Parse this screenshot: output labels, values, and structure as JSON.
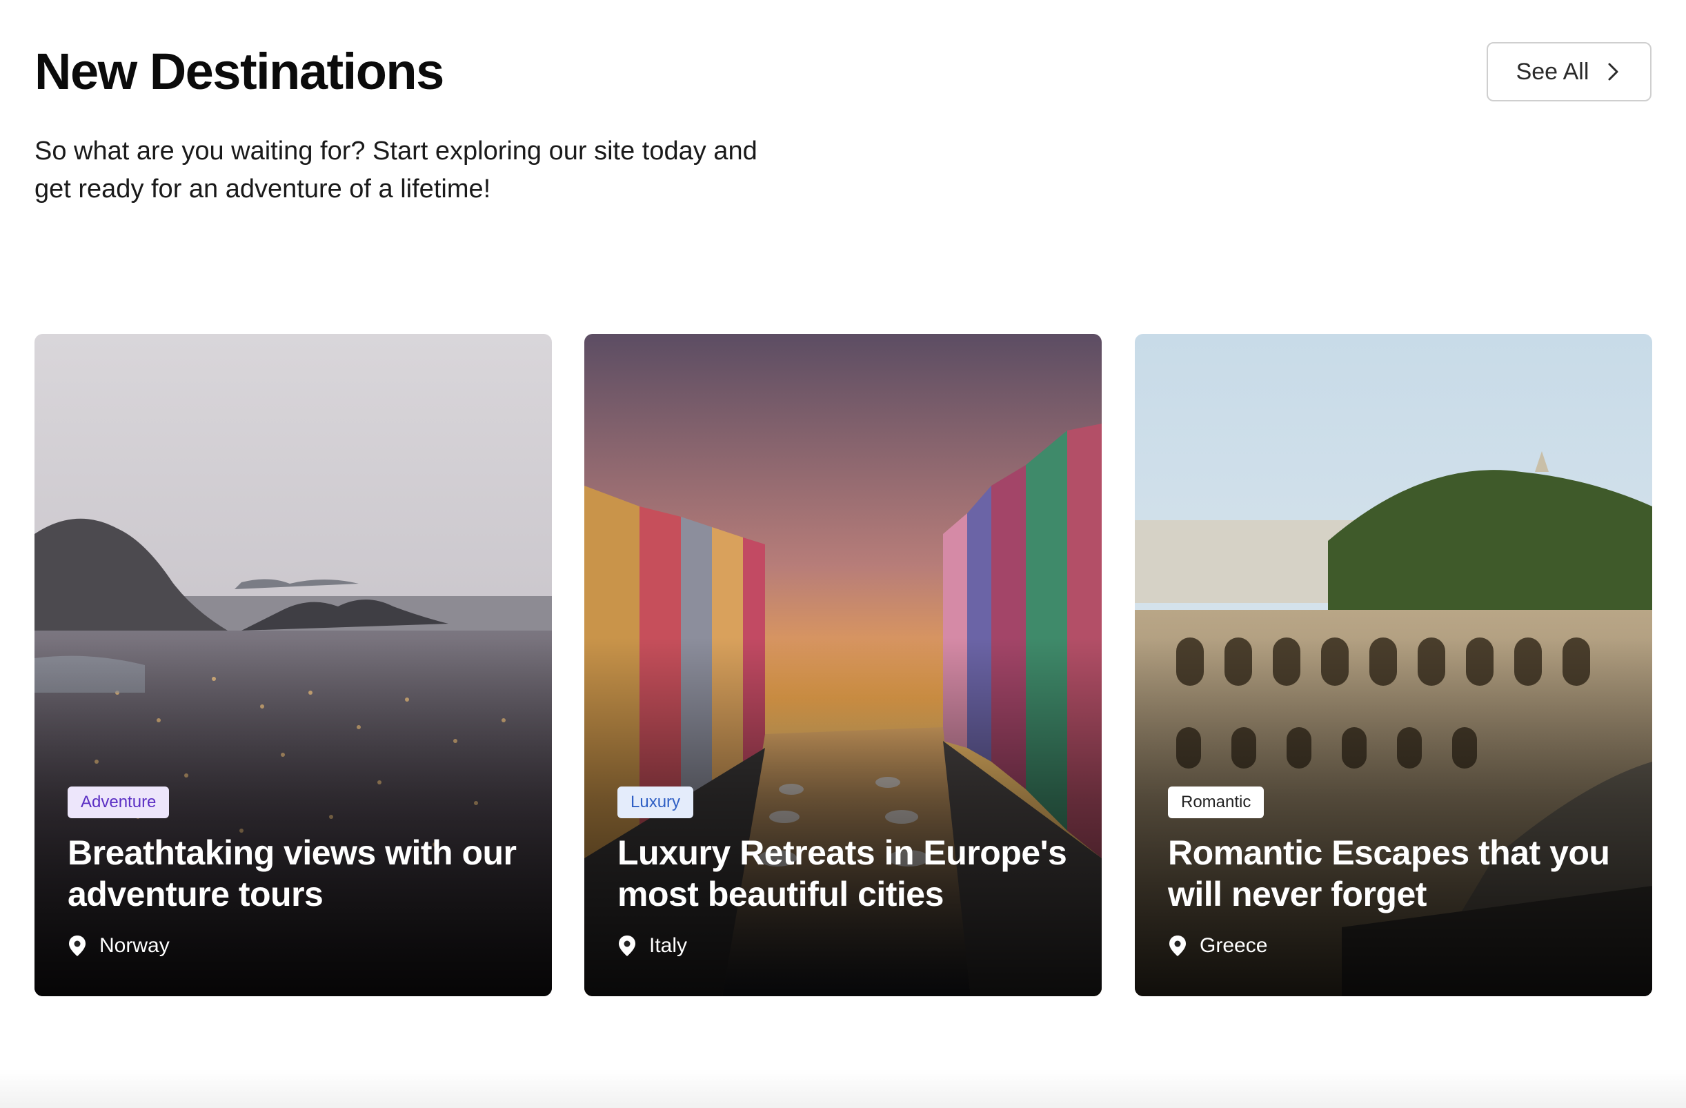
{
  "header": {
    "title": "New Destinations",
    "subtitle": "So what are you waiting for? Start exploring our site today and get ready for an adventure of a lifetime!",
    "see_all_label": "See All",
    "see_all_icon": "chevron-right-icon"
  },
  "cards": [
    {
      "category": "Adventure",
      "title": "Breathtaking views with our adventure tours",
      "location": "Norway",
      "image": "coastal town at dusk with mountains",
      "badge_bg": "#ede6fb",
      "badge_color": "#5b2fc4"
    },
    {
      "category": "Luxury",
      "title": "Luxury Retreats in Europe's most beautiful cities",
      "location": "Italy",
      "image": "colorful houses along a canal at sunset",
      "badge_bg": "#e4ecfb",
      "badge_color": "#2f5fc4"
    },
    {
      "category": "Romantic",
      "title": "Romantic Escapes that you will never forget",
      "location": "Greece",
      "image": "ancient stone theatre beneath a green hill",
      "badge_bg": "#ffffff",
      "badge_color": "#222222"
    }
  ],
  "colors": {
    "text": "#0b0b0b",
    "border": "#cfcfcf",
    "card_text": "#ffffff"
  }
}
